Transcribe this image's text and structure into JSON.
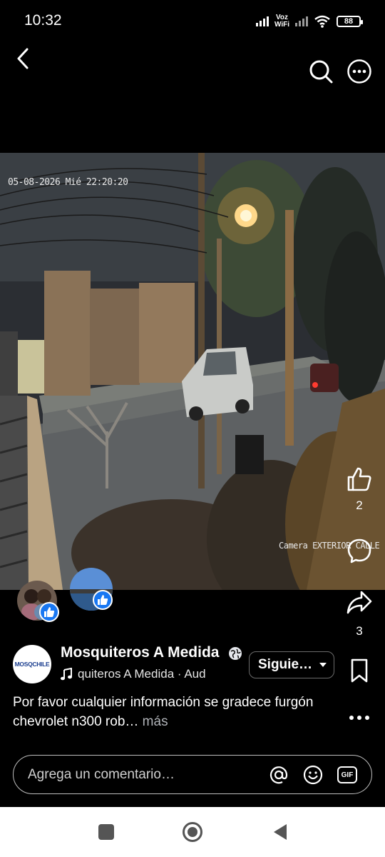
{
  "status": {
    "time": "10:32",
    "network_label_top": "Voz",
    "network_label_bottom": "WiFi",
    "battery": "88"
  },
  "video": {
    "timestamp": "05-08-2026 Mié  22:20:20",
    "camera_label": "Camera EXTERIOR CALLE"
  },
  "actions": {
    "like_count": "2",
    "share_count": "3"
  },
  "post": {
    "logo_text": "MOSQCHILE",
    "author": "Mosquiteros A Medida",
    "audio": "quiteros A Medida · Aud",
    "follow_label": "Siguie…",
    "caption": "Por favor cualquier información se gradece furgón chevrolet n300 rob…",
    "more_label": " más"
  },
  "comment": {
    "placeholder": "Agrega un comentario…",
    "gif_label": "GIF"
  },
  "colors": {
    "background": "#000000",
    "like_blue": "#1877f2",
    "nav_background": "#ffffff"
  }
}
